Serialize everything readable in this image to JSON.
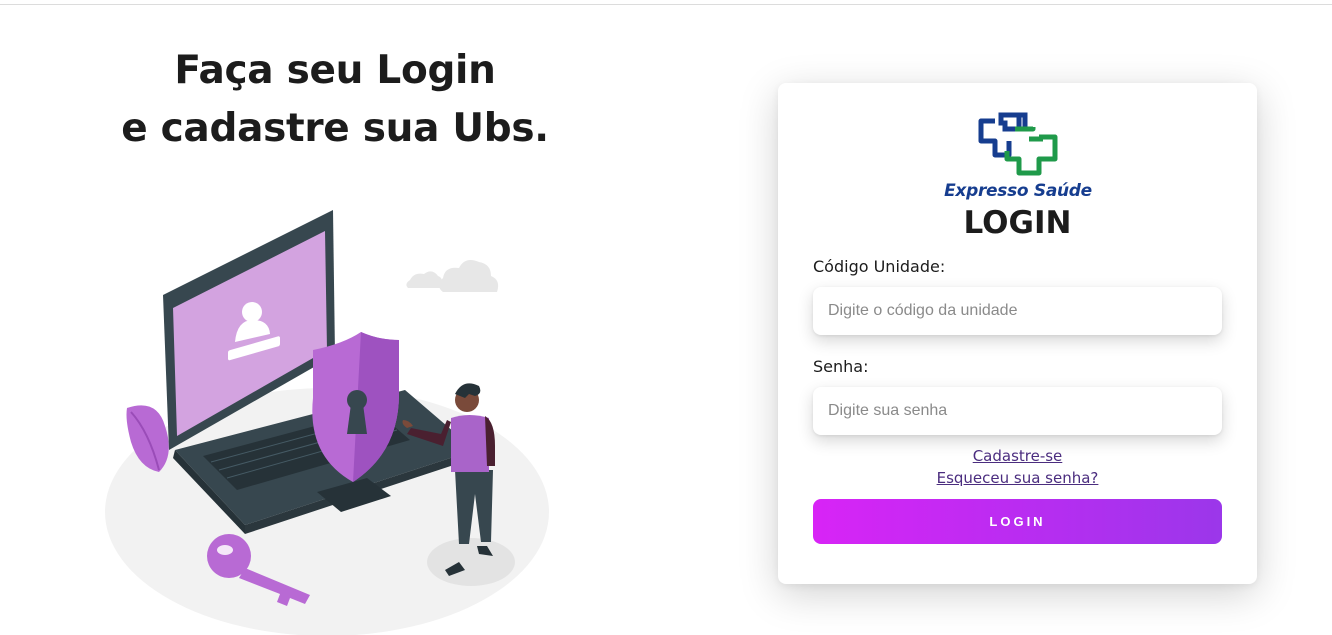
{
  "headline": {
    "line1": "Faça seu Login",
    "line2": "e cadastre sua Ubs."
  },
  "illustration": {
    "icon": "laptop-security-login-illustration"
  },
  "card": {
    "logo_text": "Expresso Saúde",
    "title": "LOGIN",
    "code_label": "Código Unidade:",
    "code_placeholder": "Digite o código da unidade",
    "code_value": "",
    "password_label": "Senha:",
    "password_placeholder": "Digite sua senha",
    "password_value": "",
    "register_link": "Cadastre-se",
    "forgot_link": "Esqueceu sua senha?",
    "login_button": "LOGIN"
  },
  "colors": {
    "accent_gradient_start": "#d824f6",
    "accent_gradient_end": "#9b37ea",
    "logo_blue": "#163d8f",
    "logo_green": "#1f9a4a",
    "illustration_purple": "#b86ad4",
    "link": "#4b2d7f"
  }
}
